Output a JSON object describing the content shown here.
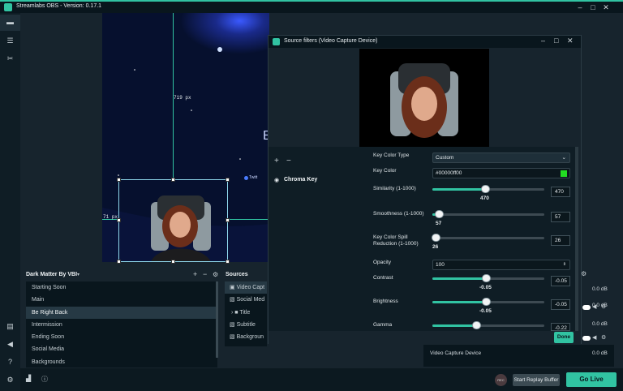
{
  "app": {
    "title": "Streamlabs OBS - Version: 0.17.1"
  },
  "window_controls": [
    "–",
    "□",
    "✕"
  ],
  "preview": {
    "guide_top_label": "719 px",
    "guide_left_label": "71 px",
    "canvas_letter": "B",
    "canvas_twitter": "Twitt"
  },
  "scenes": {
    "collection": "Dark Matter By VBI",
    "items": [
      "Starting Soon",
      "Main",
      "Be Right Back",
      "Intermission",
      "Ending Soon",
      "Social Media",
      "Backgrounds"
    ],
    "active_index": 2
  },
  "sources": {
    "title": "Sources",
    "items": [
      "Video Capt",
      "Social Med",
      "Title",
      "Subtitle",
      "Backgroun"
    ]
  },
  "mixer": {
    "rows": [
      {
        "db": "0.0 dB"
      },
      {
        "db": "0.0 dB"
      },
      {
        "db": "0.0 dB"
      },
      {
        "name": "Video Capture Device",
        "db": "0.0 dB"
      }
    ]
  },
  "dialog": {
    "title": "Source filters (Video Capture Device)",
    "filter_name": "Chroma Key",
    "done_label": "Done",
    "key_color_type": {
      "label": "Key Color Type",
      "value": "Custom"
    },
    "key_color": {
      "label": "Key Color",
      "value": "#00000ff00",
      "swatch": "#22dd22"
    },
    "sliders": [
      {
        "label": "Similarity (1-1000)",
        "value": "470",
        "fraction": 0.47
      },
      {
        "label": "Smoothness (1-1000)",
        "value": "57",
        "fraction": 0.057
      },
      {
        "label": "Key Color Spill Reduction (1-1000)",
        "value": "26",
        "fraction": 0.026
      }
    ],
    "opacity": {
      "label": "Opacity",
      "value": "100"
    },
    "adjust": [
      {
        "label": "Contrast",
        "value": "-0.05",
        "fraction": 0.475
      },
      {
        "label": "Brightness",
        "value": "-0.05",
        "fraction": 0.475
      },
      {
        "label": "Gamma",
        "value": "-0.22",
        "fraction": 0.39
      }
    ]
  },
  "bottom": {
    "rec_label": "REC",
    "replay_label": "Start Replay Buffer",
    "golive_label": "Go Live"
  },
  "colors": {
    "accent": "#31c3a2",
    "bg": "#17242d"
  }
}
